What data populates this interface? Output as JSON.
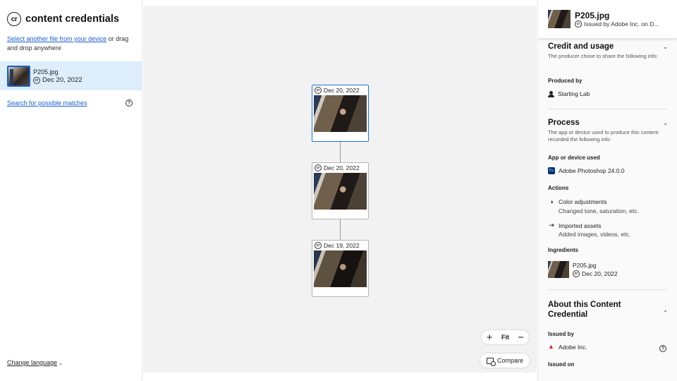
{
  "left": {
    "brand_logo": "cr",
    "brand": "content credentials",
    "select_link": "Select another file from your device",
    "select_rest": " or drag and drop anywhere",
    "file": {
      "name": "P205.jpg",
      "date": "Dec 20, 2022"
    },
    "search_link": "Search for possible matches",
    "language": "Change language"
  },
  "canvas": {
    "nodes": [
      {
        "date": "Dec 20, 2022",
        "selected": true
      },
      {
        "date": "Dec 20, 2022",
        "selected": false
      },
      {
        "date": "Dec 19, 2022",
        "selected": false
      }
    ],
    "zoom": {
      "fit_label": "Fit"
    },
    "compare_label": "Compare"
  },
  "right": {
    "header": {
      "title": "P205.jpg",
      "subtitle": "Issued by Adobe Inc. on D..."
    },
    "credit": {
      "title": "Credit and usage",
      "desc": "The producer chose to share the following info:",
      "produced_by_label": "Produced by",
      "producer": "Starling Lab"
    },
    "process": {
      "title": "Process",
      "desc": "The app or device used to produce this content recorded the following info:",
      "app_label": "App or device used",
      "app": "Adobe Photoshop 24.0.0",
      "actions_label": "Actions",
      "actions": [
        {
          "title": "Color adjustments",
          "desc": "Changed tone, saturation, etc."
        },
        {
          "title": "Imported assets",
          "desc": "Added images, videos, etc."
        }
      ],
      "ingredients_label": "Ingredients",
      "ingredient": {
        "name": "P205.jpg",
        "date": "Dec 20, 2022"
      }
    },
    "about": {
      "title": "About this Content Credential",
      "issued_by_label": "Issued by",
      "issuer": "Adobe Inc.",
      "issued_on_label": "Issued on"
    }
  },
  "colors": {
    "accent": "#1a5fd1",
    "selected_row": "#deeefc",
    "canvas_bg": "#f2f2f2"
  }
}
